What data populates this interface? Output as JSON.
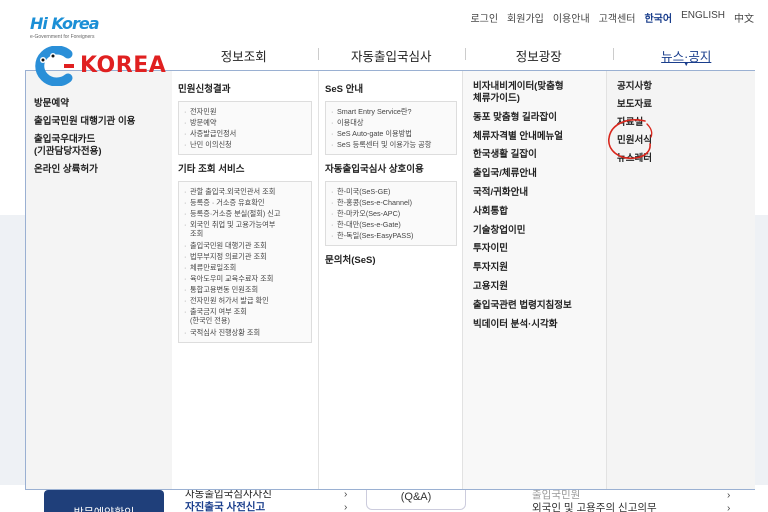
{
  "brand": {
    "top_logo_mark": "Hi Korea",
    "top_logo_sub": "e-Government for Foreigners",
    "ck_logo_text": "KOREA",
    "ck_accent": "#e02020"
  },
  "util": {
    "login": "로그인",
    "signup": "회원가입",
    "guide": "이용안내",
    "support": "고객센터",
    "lang_ko": "한국어",
    "lang_en": "ENGLISH",
    "lang_zh": "中文"
  },
  "mainnav": [
    {
      "label": "정보조회"
    },
    {
      "label": "자동출입국심사"
    },
    {
      "label": "정보광장"
    },
    {
      "label": "뉴스·공지"
    }
  ],
  "mega": {
    "col0": [
      "방문예약",
      "출입국민원 대행기관 이용",
      "출입국우대카드\n(기관담당자전용)",
      "온라인 상륙허가"
    ],
    "col1": {
      "sec1_title": "민원신청결과",
      "sec1_items": [
        "전자민원",
        "방문예약",
        "사증발급인정서",
        "난민 이의신청"
      ],
      "sec2_title": "기타 조회 서비스",
      "sec2_items": [
        "관할 출입국.외국인관서 조회",
        "등록증 · 거소증 유효확인",
        "등록증·거소증 분실(절회) 신고",
        "외국인 취업 및 고용가능여부\n조회",
        "출입국민원 대행기관 조회",
        "법무부지정 의료기관 조회",
        "체류만료일조회",
        "육아도우미 교육수료자 조회",
        "통합고용변동 민원조회",
        "전자민원 허가서 발급 확인",
        "출국금지 여부 조회\n(한국인 전용)",
        "국적심사 진행상황 조회"
      ]
    },
    "col2": {
      "sec1_title": "SeS 안내",
      "sec1_items": [
        "Smart Entry Service란?",
        "이용대상",
        "SeS Auto-gate 이용방법",
        "SeS 등록센터 및 이용가능 공항"
      ],
      "sec2_title": "자동출입국심사 상호이용",
      "sec2_items": [
        "한-미국(SeS-GE)",
        "한-홍콩(Ses-e-Channel)",
        "한-마카오(Ses-APC)",
        "한-대만(Ses-e-Gate)",
        "한-독일(Ses-EasyPASS)"
      ],
      "sec3_title": "문의처(SeS)"
    },
    "col3": [
      "비자내비게이터(맞춤형\n체류가이드)",
      "동포 맞춤형 길라잡이",
      "체류자격별 안내메뉴얼",
      "한국생활 길잡이",
      "출입국/체류안내",
      "국적/귀화안내",
      "사회통합",
      "기술창업이민",
      "투자이민",
      "투자지원",
      "고용지원",
      "출입국관련 법령지침정보",
      "빅데이터 분석·시각화"
    ],
    "col4": [
      "공지사항",
      "보도자료",
      "자료실",
      "민원서식",
      "뉴스레터"
    ]
  },
  "background": {
    "visit_button": "방문예약확인",
    "list_line1": "자동출입국심사자진",
    "list_line2": "자진출국 사전신고",
    "qa_label": "(Q&A)",
    "right_line1": "출입국민원",
    "right_line2": "외국인 및 고용주의 신고의무"
  },
  "colors": {
    "nav_active": "#1a3e8c",
    "mega_border": "#9ab0d2",
    "annotation_red": "#d9261c"
  }
}
